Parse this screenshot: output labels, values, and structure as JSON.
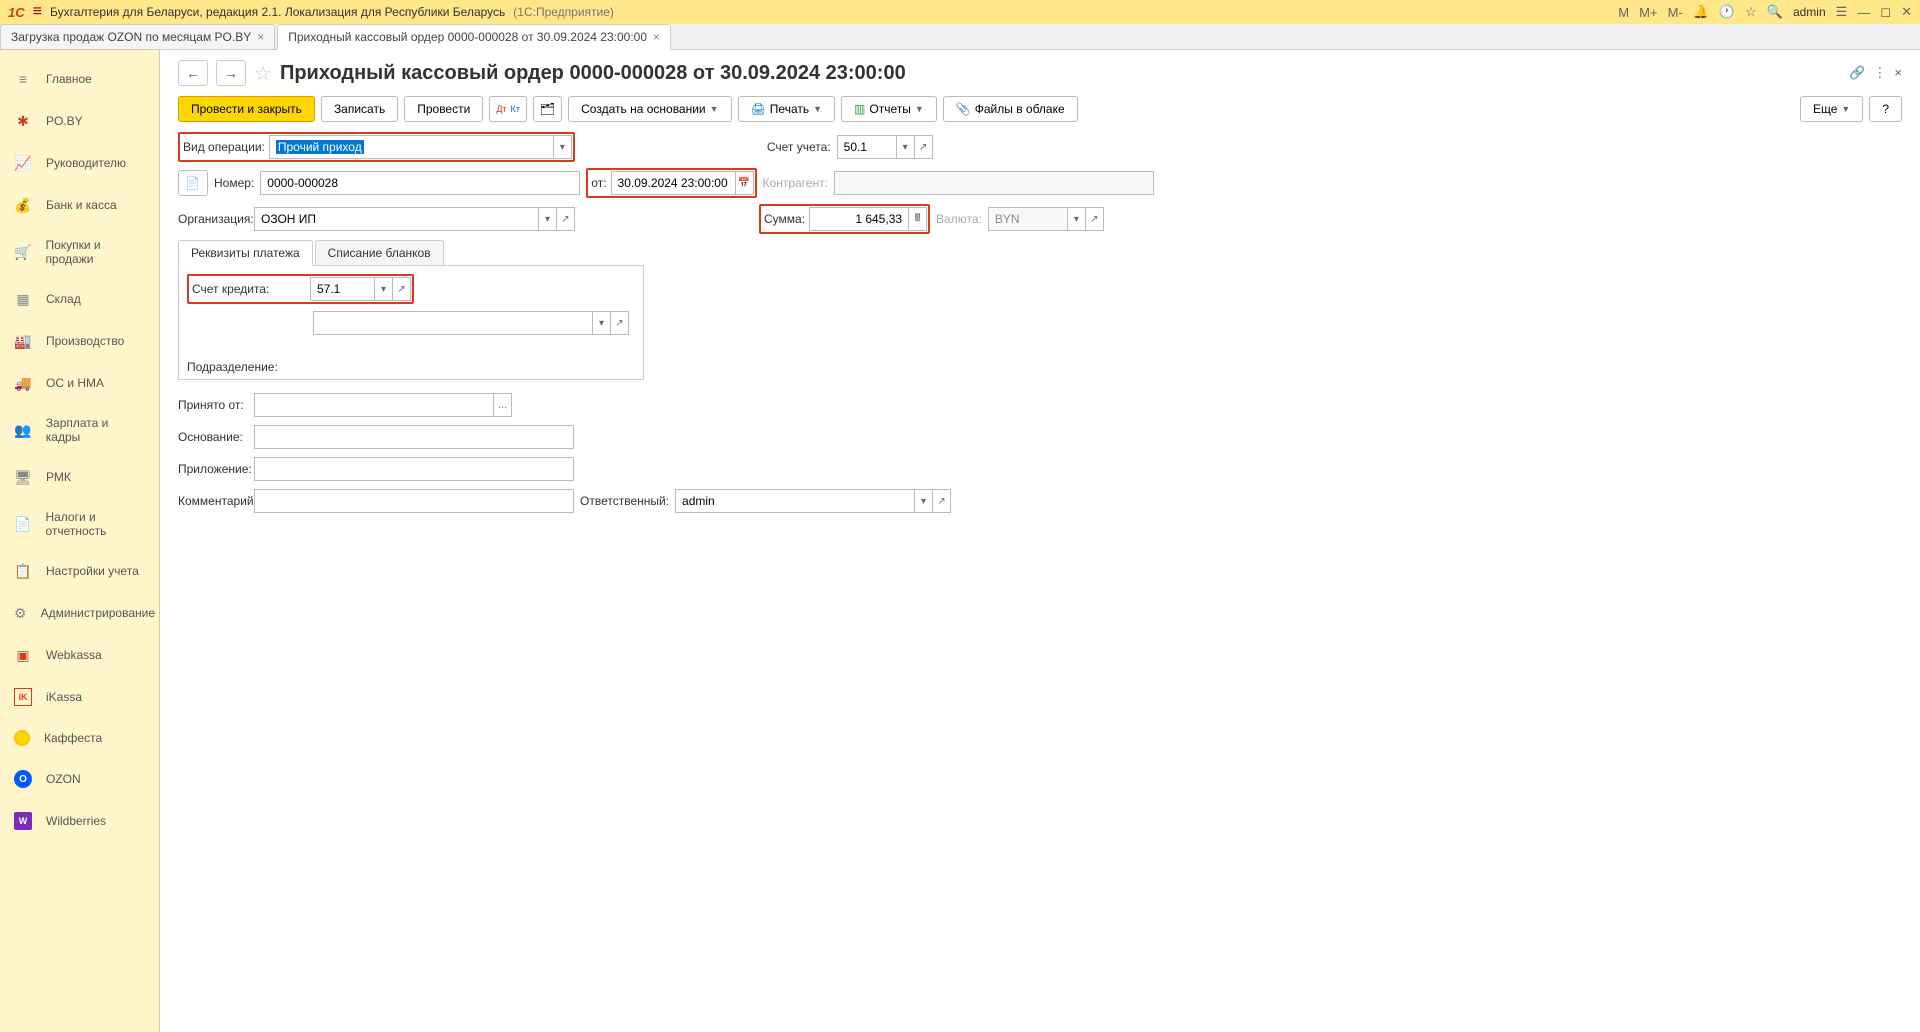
{
  "header": {
    "app_name": "Бухгалтерия для Беларуси, редакция 2.1. Локализация для Республики Беларусь",
    "platform": "(1С:Предприятие)",
    "user": "admin",
    "m_label": "M",
    "m_plus": "M+",
    "m_minus": "M-"
  },
  "tabs": {
    "tab1": "Загрузка продаж OZON по месяцам PO.BY",
    "tab2": "Приходный кассовый ордер 0000-000028 от 30.09.2024 23:00:00"
  },
  "sidebar": {
    "items": [
      "Главное",
      "PO.BY",
      "Руководителю",
      "Банк и касса",
      "Покупки и продажи",
      "Склад",
      "Производство",
      "ОС и НМА",
      "Зарплата и кадры",
      "РМК",
      "Налоги и отчетность",
      "Настройки учета",
      "Администрирование",
      "Webkassa",
      "iKassa",
      "Каффеста",
      "OZON",
      "Wildberries"
    ]
  },
  "page": {
    "title": "Приходный кассовый ордер 0000-000028 от 30.09.2024 23:00:00"
  },
  "toolbar": {
    "post_close": "Провести и закрыть",
    "save": "Записать",
    "post": "Провести",
    "create_based": "Создать на основании",
    "print": "Печать",
    "reports": "Отчеты",
    "files": "Файлы в облаке",
    "more": "Еще",
    "help": "?"
  },
  "form": {
    "operation_type_label": "Вид операции:",
    "operation_type_value": "Прочий приход",
    "account_label": "Счет учета:",
    "account_value": "50.1",
    "number_label": "Номер:",
    "number_value": "0000-000028",
    "date_label": "от:",
    "date_value": "30.09.2024 23:00:00",
    "counterparty_label": "Контрагент:",
    "counterparty_value": "",
    "org_label": "Организация:",
    "org_value": "ОЗОН ИП",
    "amount_label": "Сумма:",
    "amount_value": "1 645,33",
    "currency_label": "Валюта:",
    "currency_value": "BYN",
    "inner_tab1": "Реквизиты платежа",
    "inner_tab2": "Списание бланков",
    "credit_account_label": "Счет кредита:",
    "credit_account_value": "57.1",
    "division_label": "Подразделение:",
    "received_from_label": "Принято от:",
    "basis_label": "Основание:",
    "attachment_label": "Приложение:",
    "comment_label": "Комментарий:",
    "responsible_label": "Ответственный:",
    "responsible_value": "admin"
  }
}
